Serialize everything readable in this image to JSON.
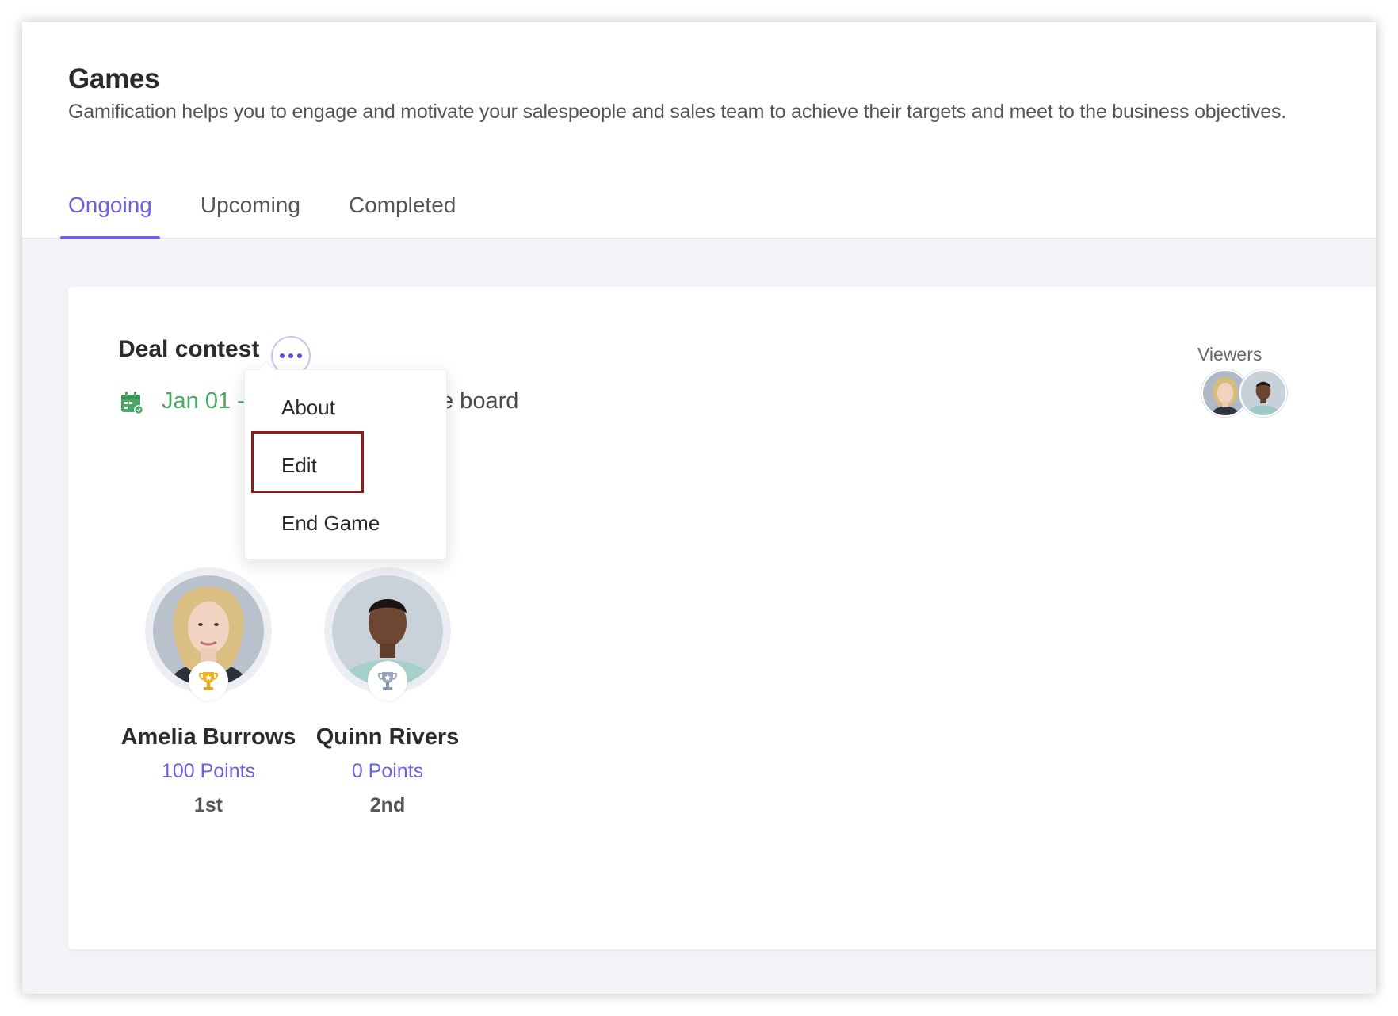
{
  "header": {
    "title": "Games",
    "subtitle": "Gamification helps you to engage and motivate your salespeople and sales team to achieve their targets and meet to the business objectives."
  },
  "tabs": [
    {
      "label": "Ongoing",
      "active": true
    },
    {
      "label": "Upcoming",
      "active": false
    },
    {
      "label": "Completed",
      "active": false
    }
  ],
  "game": {
    "title": "Deal contest",
    "date_range": "Jan 01 - Ja",
    "board_text": "e board",
    "viewers_label": "Viewers",
    "viewers": [
      {
        "icon": "female-avatar"
      },
      {
        "icon": "male-avatar"
      }
    ]
  },
  "leaderboard": [
    {
      "name": "Amelia Burrows",
      "points": "100 Points",
      "rank": "1st",
      "trophy": "gold-trophy-icon"
    },
    {
      "name": "Quinn Rivers",
      "points": "0 Points",
      "rank": "2nd",
      "trophy": "silver-trophy-icon"
    }
  ],
  "menu": {
    "items": [
      "About",
      "Edit",
      "End Game"
    ],
    "highlighted": "Edit"
  },
  "colors": {
    "accent": "#6d62e0",
    "date_green": "#4aa765",
    "highlight_border": "#8b1d1d",
    "gold": "#f0b323",
    "silver": "#9aa6bf"
  }
}
